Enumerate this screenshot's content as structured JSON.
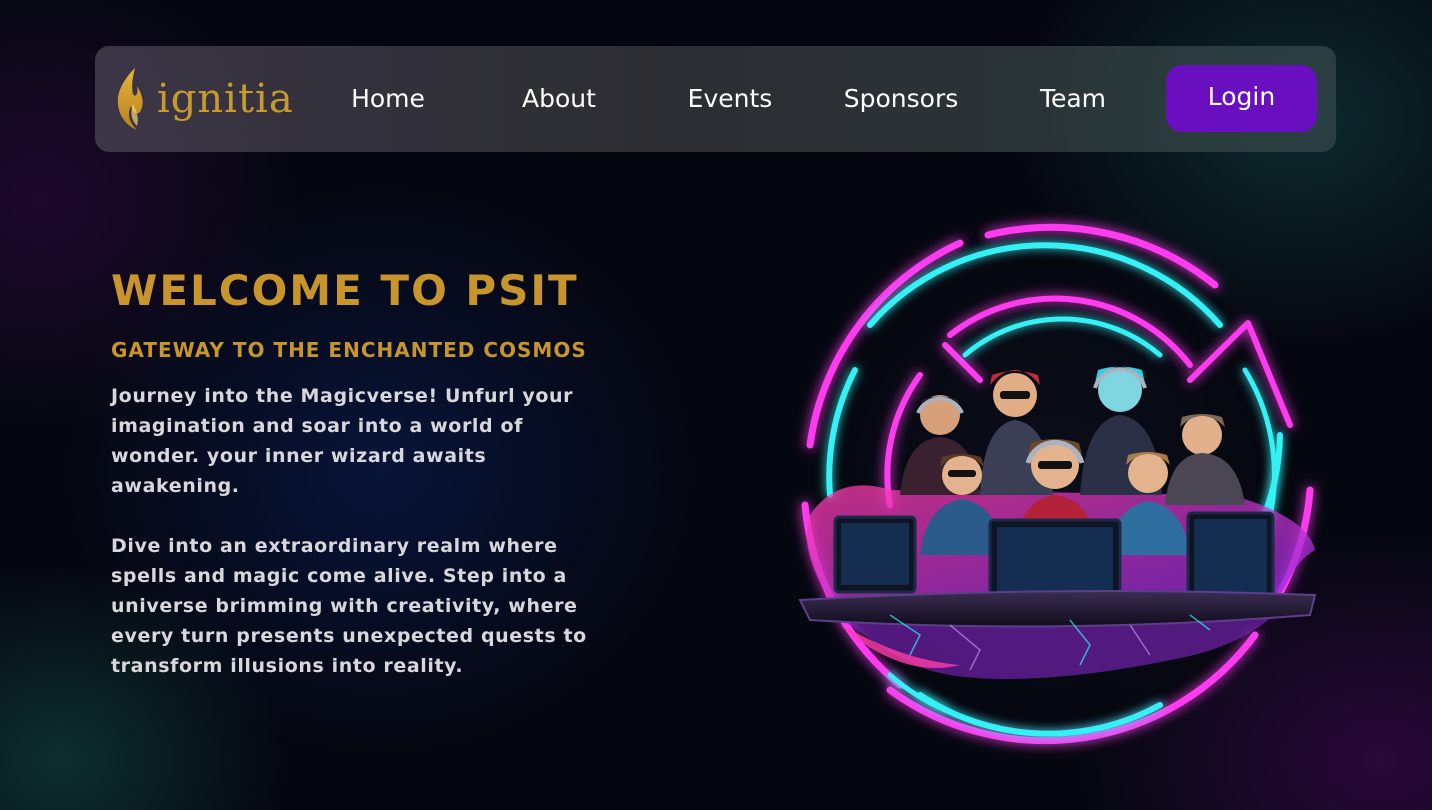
{
  "brand": {
    "logo_text": "ignitia",
    "logo_icon": "flame-icon",
    "color": "#c79a2c"
  },
  "nav": {
    "items": [
      {
        "label": "Home"
      },
      {
        "label": "About"
      },
      {
        "label": "Events"
      },
      {
        "label": "Sponsors"
      },
      {
        "label": "Team"
      }
    ],
    "login_label": "Login",
    "login_color": "#6a0fc0"
  },
  "hero": {
    "title": "WELCOME TO PSIT",
    "subtitle": "GATEWAY TO THE ENCHANTED COSMOS",
    "paragraph_1": "Journey into the Magicverse! Unfurl your imagination and soar into a world of wonder. your inner wizard awaits awakening.",
    "paragraph_2": "Dive into an extraordinary realm where spells and magic come alive. Step into a universe brimming with creativity, where every turn presents unexpected quests to transform illusions into reality.",
    "accent_color": "#c8952c"
  },
  "illustration": {
    "subject": "neon-gamers-illustration",
    "neon_colors": [
      "#ff2bf0",
      "#34f0f4"
    ]
  }
}
